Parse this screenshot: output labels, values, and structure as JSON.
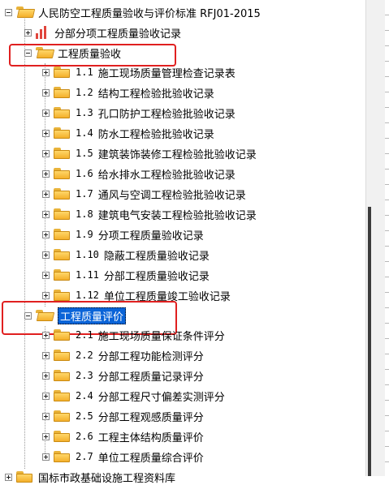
{
  "tree": {
    "root": {
      "label": "人民防空工程质量验收与评价标准 RFJ01-2015"
    },
    "record_node": {
      "label": "分部分项工程质量验收记录"
    },
    "acceptance": {
      "label": "工程质量验收",
      "children": [
        {
          "num": "1.1",
          "label": "施工现场质量管理检查记录表"
        },
        {
          "num": "1.2",
          "label": "结构工程检验批验收记录"
        },
        {
          "num": "1.3",
          "label": "孔口防护工程检验批验收记录"
        },
        {
          "num": "1.4",
          "label": "防水工程检验批验收记录"
        },
        {
          "num": "1.5",
          "label": "建筑装饰装修工程检验批验收记录"
        },
        {
          "num": "1.6",
          "label": "给水排水工程检验批验收记录"
        },
        {
          "num": "1.7",
          "label": "通风与空调工程检验批验收记录"
        },
        {
          "num": "1.8",
          "label": "建筑电气安装工程检验批验收记录"
        },
        {
          "num": "1.9",
          "label": "分项工程质量验收记录"
        },
        {
          "num": "1.10",
          "label": "隐蔽工程质量验收记录"
        },
        {
          "num": "1.11",
          "label": "分部工程质量验收记录"
        },
        {
          "num": "1.12",
          "label": "单位工程质量竣工验收记录"
        }
      ]
    },
    "evaluation": {
      "label": "工程质量评价",
      "children": [
        {
          "num": "2.1",
          "label": "施工现场质量保证条件评分"
        },
        {
          "num": "2.2",
          "label": "分部工程功能检测评分"
        },
        {
          "num": "2.3",
          "label": "分部工程质量记录评分"
        },
        {
          "num": "2.4",
          "label": "分部工程尺寸偏差实测评分"
        },
        {
          "num": "2.5",
          "label": "分部工程观感质量评分"
        },
        {
          "num": "2.6",
          "label": "工程主体结构质量评价"
        },
        {
          "num": "2.7",
          "label": "单位工程质量综合评价"
        }
      ]
    },
    "next_root": {
      "label": "国标市政基础设施工程资料库"
    }
  },
  "colors": {
    "highlight": "#e02020",
    "selection": "#0a64d8",
    "folder": "#f4b02b"
  }
}
